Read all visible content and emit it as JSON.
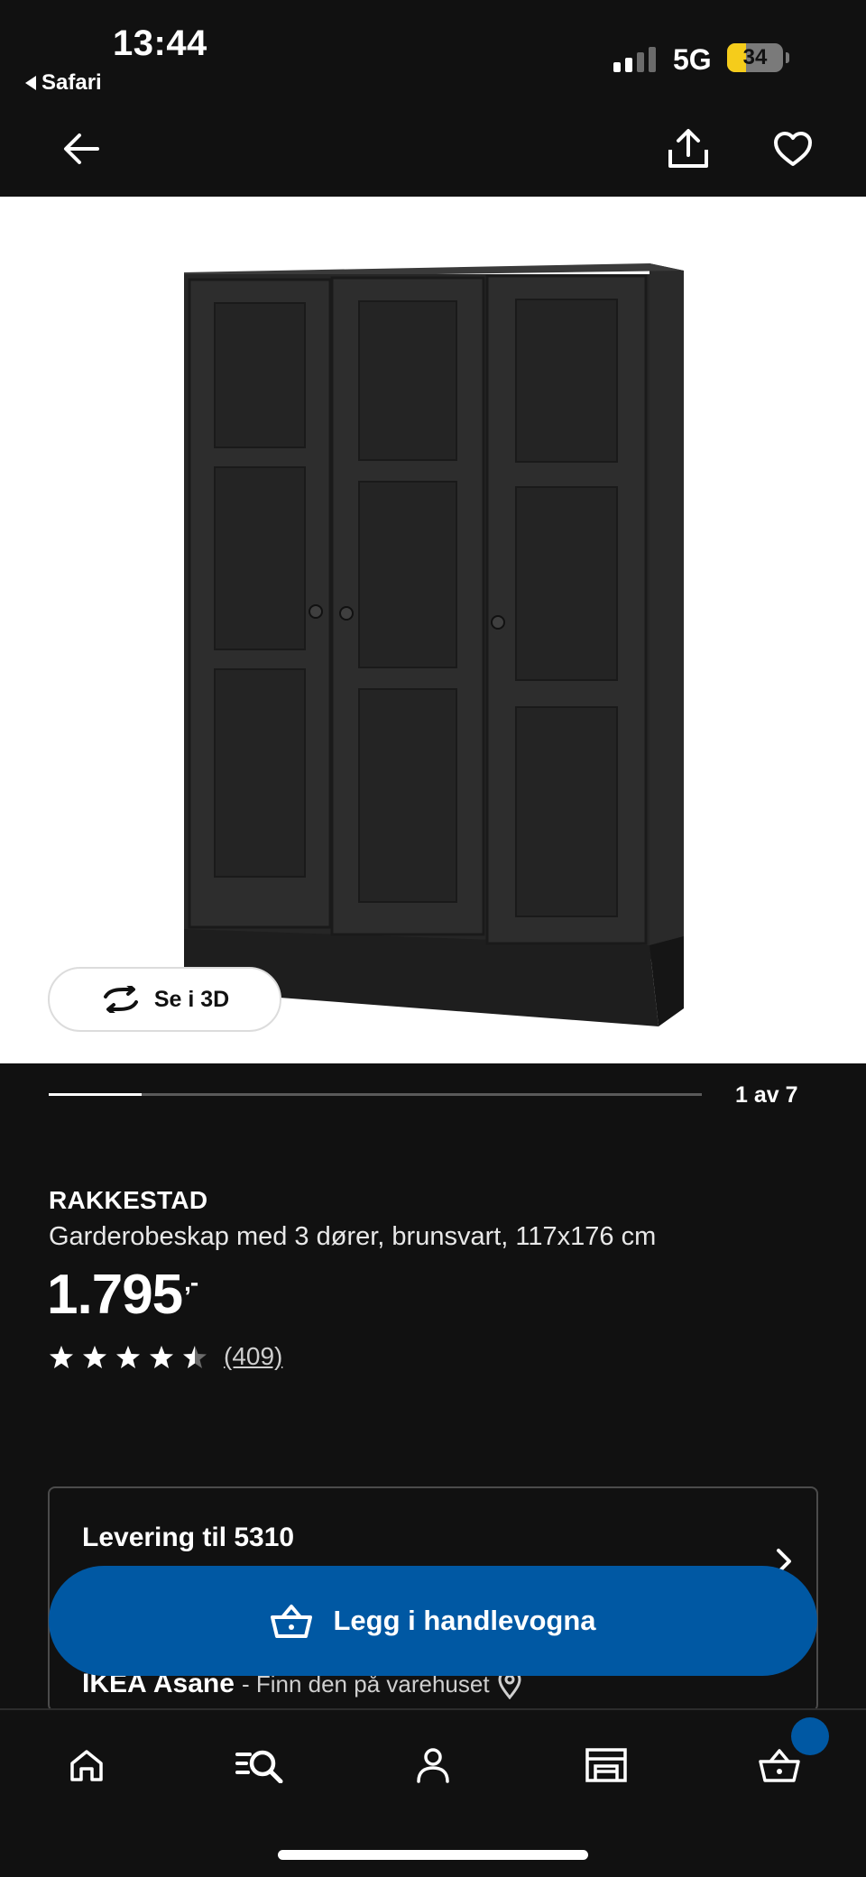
{
  "status_bar": {
    "time": "13:44",
    "back_app": "Safari",
    "network": "5G",
    "battery_level": "34",
    "battery_fraction": 0.34
  },
  "nav": {
    "back_icon": "arrow-left-icon",
    "share_icon": "share-icon",
    "favorite_icon": "heart-icon"
  },
  "gallery": {
    "view_3d_label": "Se i 3D",
    "view_3d_icon": "rotate-3d-icon",
    "pager_text": "1 av 7",
    "current_index": 1,
    "total_images": 7
  },
  "product": {
    "brand": "RAKKESTAD",
    "description": "Garderobeskap med 3 dører, brunsvart, 117x176 cm",
    "price_main": "1.795",
    "price_suffix": ",-",
    "rating_value": 4.5,
    "rating_max": 5,
    "review_count": "(409)"
  },
  "availability": {
    "delivery_label": "Levering til 5310",
    "store_name": "IKEA Åsane",
    "store_note": " - Finn den på varehuset"
  },
  "cta": {
    "add_to_cart_label": "Legg i handlevogna",
    "icon": "basket-icon"
  },
  "tabbar": {
    "items": [
      "home-icon",
      "search-icon",
      "profile-icon",
      "store-icon",
      "cart-icon"
    ]
  },
  "colors": {
    "background": "#111111",
    "accent_blue": "#0058a3",
    "battery_yellow": "#f5cc1b"
  }
}
